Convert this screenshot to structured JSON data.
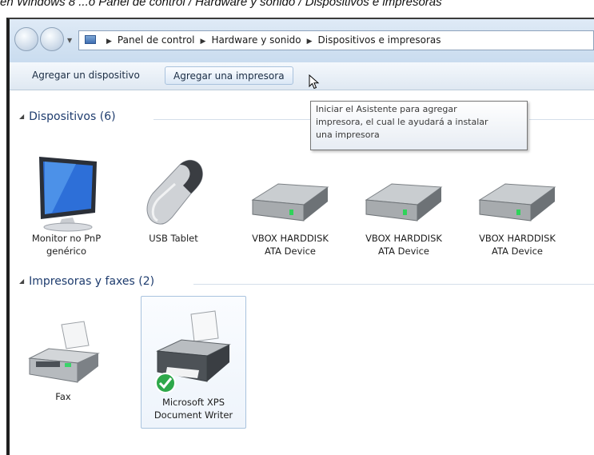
{
  "caption": "en Windows 8 ...o Panel de control / Hardware y sonido / Dispositivos e impresoras",
  "address": {
    "crumbs": [
      "Panel de control",
      "Hardware y sonido",
      "Dispositivos e impresoras"
    ]
  },
  "toolbar": {
    "add_device": "Agregar un dispositivo",
    "add_printer": "Agregar una impresora"
  },
  "tooltip": {
    "line1": "Iniciar el Asistente para agregar",
    "line2": "impresora, el cual le ayudará a instalar",
    "line3": "una impresora"
  },
  "groups": {
    "devices": {
      "title": "Dispositivos (6)",
      "items": [
        {
          "line1": "Monitor no PnP",
          "line2": "genérico",
          "icon": "monitor-icon"
        },
        {
          "line1": "USB Tablet",
          "line2": "",
          "icon": "mouse-icon"
        },
        {
          "line1": "VBOX HARDDISK",
          "line2": "ATA Device",
          "icon": "harddisk-icon"
        },
        {
          "line1": "VBOX HARDDISK",
          "line2": "ATA Device",
          "icon": "harddisk-icon"
        },
        {
          "line1": "VBOX HARDDISK",
          "line2": "ATA Device",
          "icon": "harddisk-icon"
        }
      ]
    },
    "printers": {
      "title": "Impresoras y faxes (2)",
      "items": [
        {
          "line1": "Fax",
          "line2": "",
          "icon": "fax-icon"
        },
        {
          "line1": "Microsoft XPS",
          "line2": "Document Writer",
          "icon": "printer-icon",
          "default": true
        }
      ]
    }
  },
  "colors": {
    "group_title": "#1e3c6e",
    "toolbar_text": "#1b2d44",
    "default_check": "#2ea84a"
  }
}
